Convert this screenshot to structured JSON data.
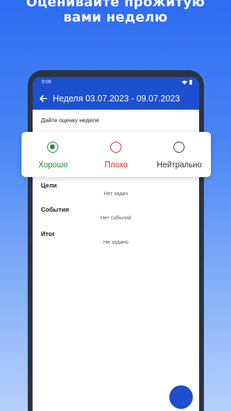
{
  "promo": {
    "title_line1": "Оценивайте прожитую",
    "title_line2": "вами неделю"
  },
  "status_bar": {
    "time": "9:09"
  },
  "app_bar": {
    "title": "Неделя 03.07.2023 - 09.07.2023"
  },
  "rating": {
    "prompt": "Дайте оценку неделе",
    "options": [
      {
        "label": "Хорошо",
        "selected": true,
        "color": "#1e8a3c"
      },
      {
        "label": "Плохо",
        "selected": false,
        "color": "#e02020"
      },
      {
        "label": "Нейтрально",
        "selected": false,
        "color": "#333333"
      }
    ]
  },
  "sections": [
    {
      "label": "Цели",
      "value": "Нет задач"
    },
    {
      "label": "События",
      "value": "Нет событий"
    },
    {
      "label": "Итог",
      "value": "Не задано"
    }
  ],
  "colors": {
    "primary": "#1d4fcf",
    "background_top": "#2d6cf2"
  }
}
